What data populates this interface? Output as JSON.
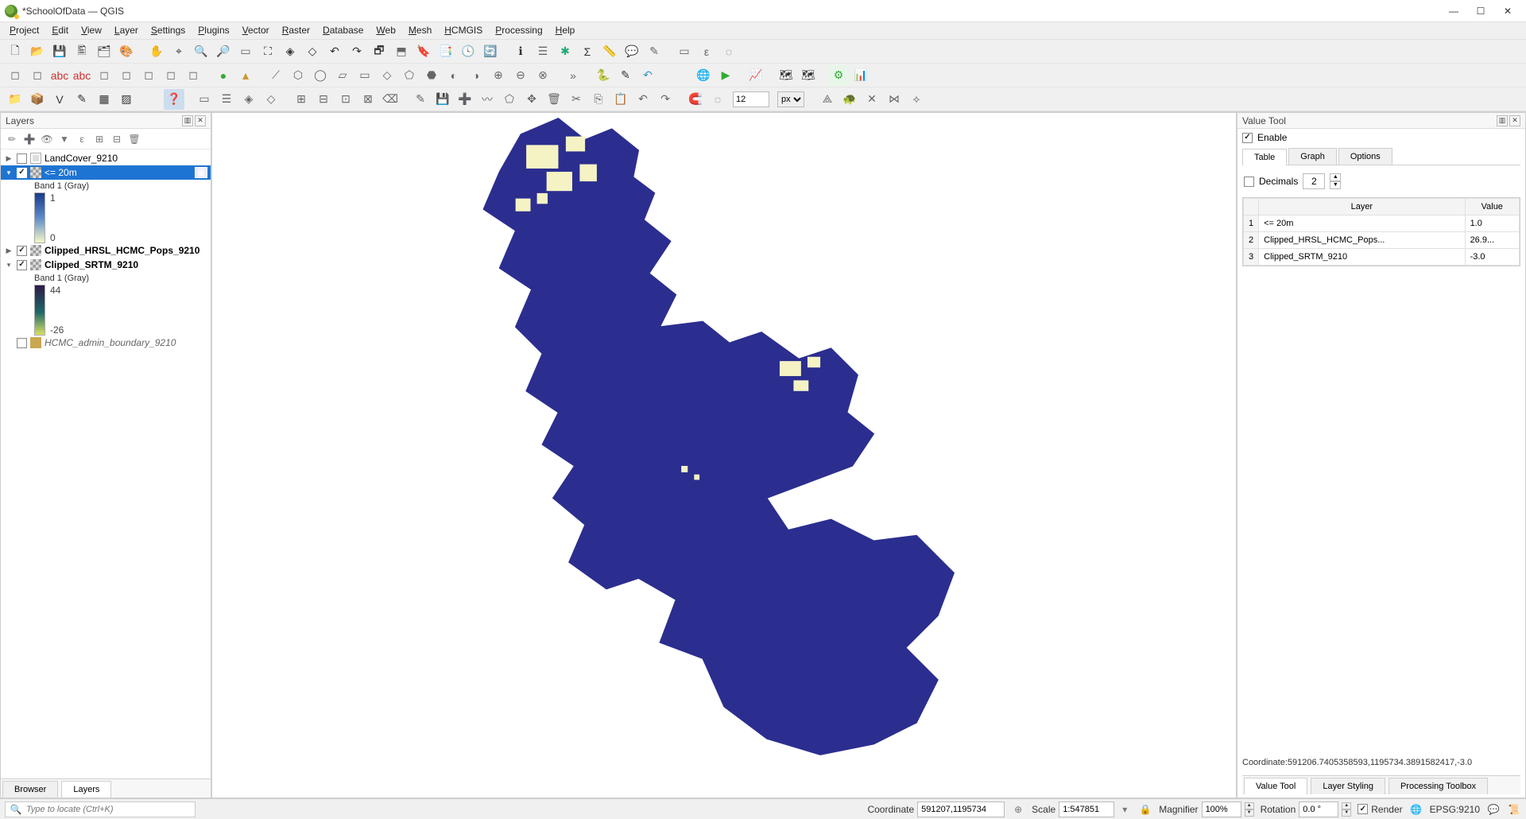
{
  "window": {
    "title": "*SchoolOfData — QGIS"
  },
  "menus": [
    "Project",
    "Edit",
    "View",
    "Layer",
    "Settings",
    "Plugins",
    "Vector",
    "Raster",
    "Database",
    "Web",
    "Mesh",
    "HCMGIS",
    "Processing",
    "Help"
  ],
  "toolbar3": {
    "value": "12",
    "unit": "px"
  },
  "layers_panel": {
    "title": "Layers",
    "items": [
      {
        "id": 0,
        "expander": "▶",
        "checked": false,
        "icon": "group",
        "name": "LandCover_9210",
        "bold": false,
        "selected": false
      },
      {
        "id": 1,
        "expander": "▾",
        "checked": true,
        "icon": "raster",
        "name": "<= 20m",
        "bold": false,
        "selected": true,
        "badge": "▦",
        "legend": {
          "band": "Band 1 (Gray)",
          "ramp": "ramp1",
          "top": "1",
          "bottom": "0"
        }
      },
      {
        "id": 2,
        "expander": "▶",
        "checked": true,
        "icon": "raster",
        "name": "Clipped_HRSL_HCMC_Pops_9210",
        "bold": true,
        "selected": false
      },
      {
        "id": 3,
        "expander": "▾",
        "checked": true,
        "icon": "raster",
        "name": "Clipped_SRTM_9210",
        "bold": true,
        "selected": false,
        "legend": {
          "band": "Band 1 (Gray)",
          "ramp": "ramp2",
          "top": "44",
          "bottom": "-26"
        }
      },
      {
        "id": 4,
        "expander": "",
        "checked": false,
        "icon": "poly",
        "name": "HCMC_admin_boundary_9210",
        "bold": false,
        "italic": true,
        "selected": false
      }
    ],
    "tabs": {
      "browser": "Browser",
      "layers": "Layers"
    }
  },
  "value_tool": {
    "title": "Value Tool",
    "enable_label": "Enable",
    "enable_checked": true,
    "tabs": {
      "table": "Table",
      "graph": "Graph",
      "options": "Options"
    },
    "decimals_label": "Decimals",
    "decimals_value": "2",
    "decimals_checked": false,
    "columns": {
      "layer": "Layer",
      "value": "Value"
    },
    "rows": [
      {
        "n": "1",
        "layer": "<= 20m",
        "value": "1.0"
      },
      {
        "n": "2",
        "layer": "Clipped_HRSL_HCMC_Pops...",
        "value": "26.9..."
      },
      {
        "n": "3",
        "layer": "Clipped_SRTM_9210",
        "value": "-3.0"
      }
    ],
    "coord": "Coordinate:591206.7405358593,1195734.3891582417,-3.0",
    "bottom_tabs": {
      "vt": "Value Tool",
      "ls": "Layer Styling",
      "pt": "Processing Toolbox"
    }
  },
  "status": {
    "locator_placeholder": "Type to locate (Ctrl+K)",
    "coord_label": "Coordinate",
    "coord_value": "591207,1195734",
    "scale_label": "Scale",
    "scale_value": "1:547851",
    "mag_label": "Magnifier",
    "mag_value": "100%",
    "rot_label": "Rotation",
    "rot_value": "0.0 °",
    "render_label": "Render",
    "render_checked": true,
    "crs": "EPSG:9210"
  }
}
